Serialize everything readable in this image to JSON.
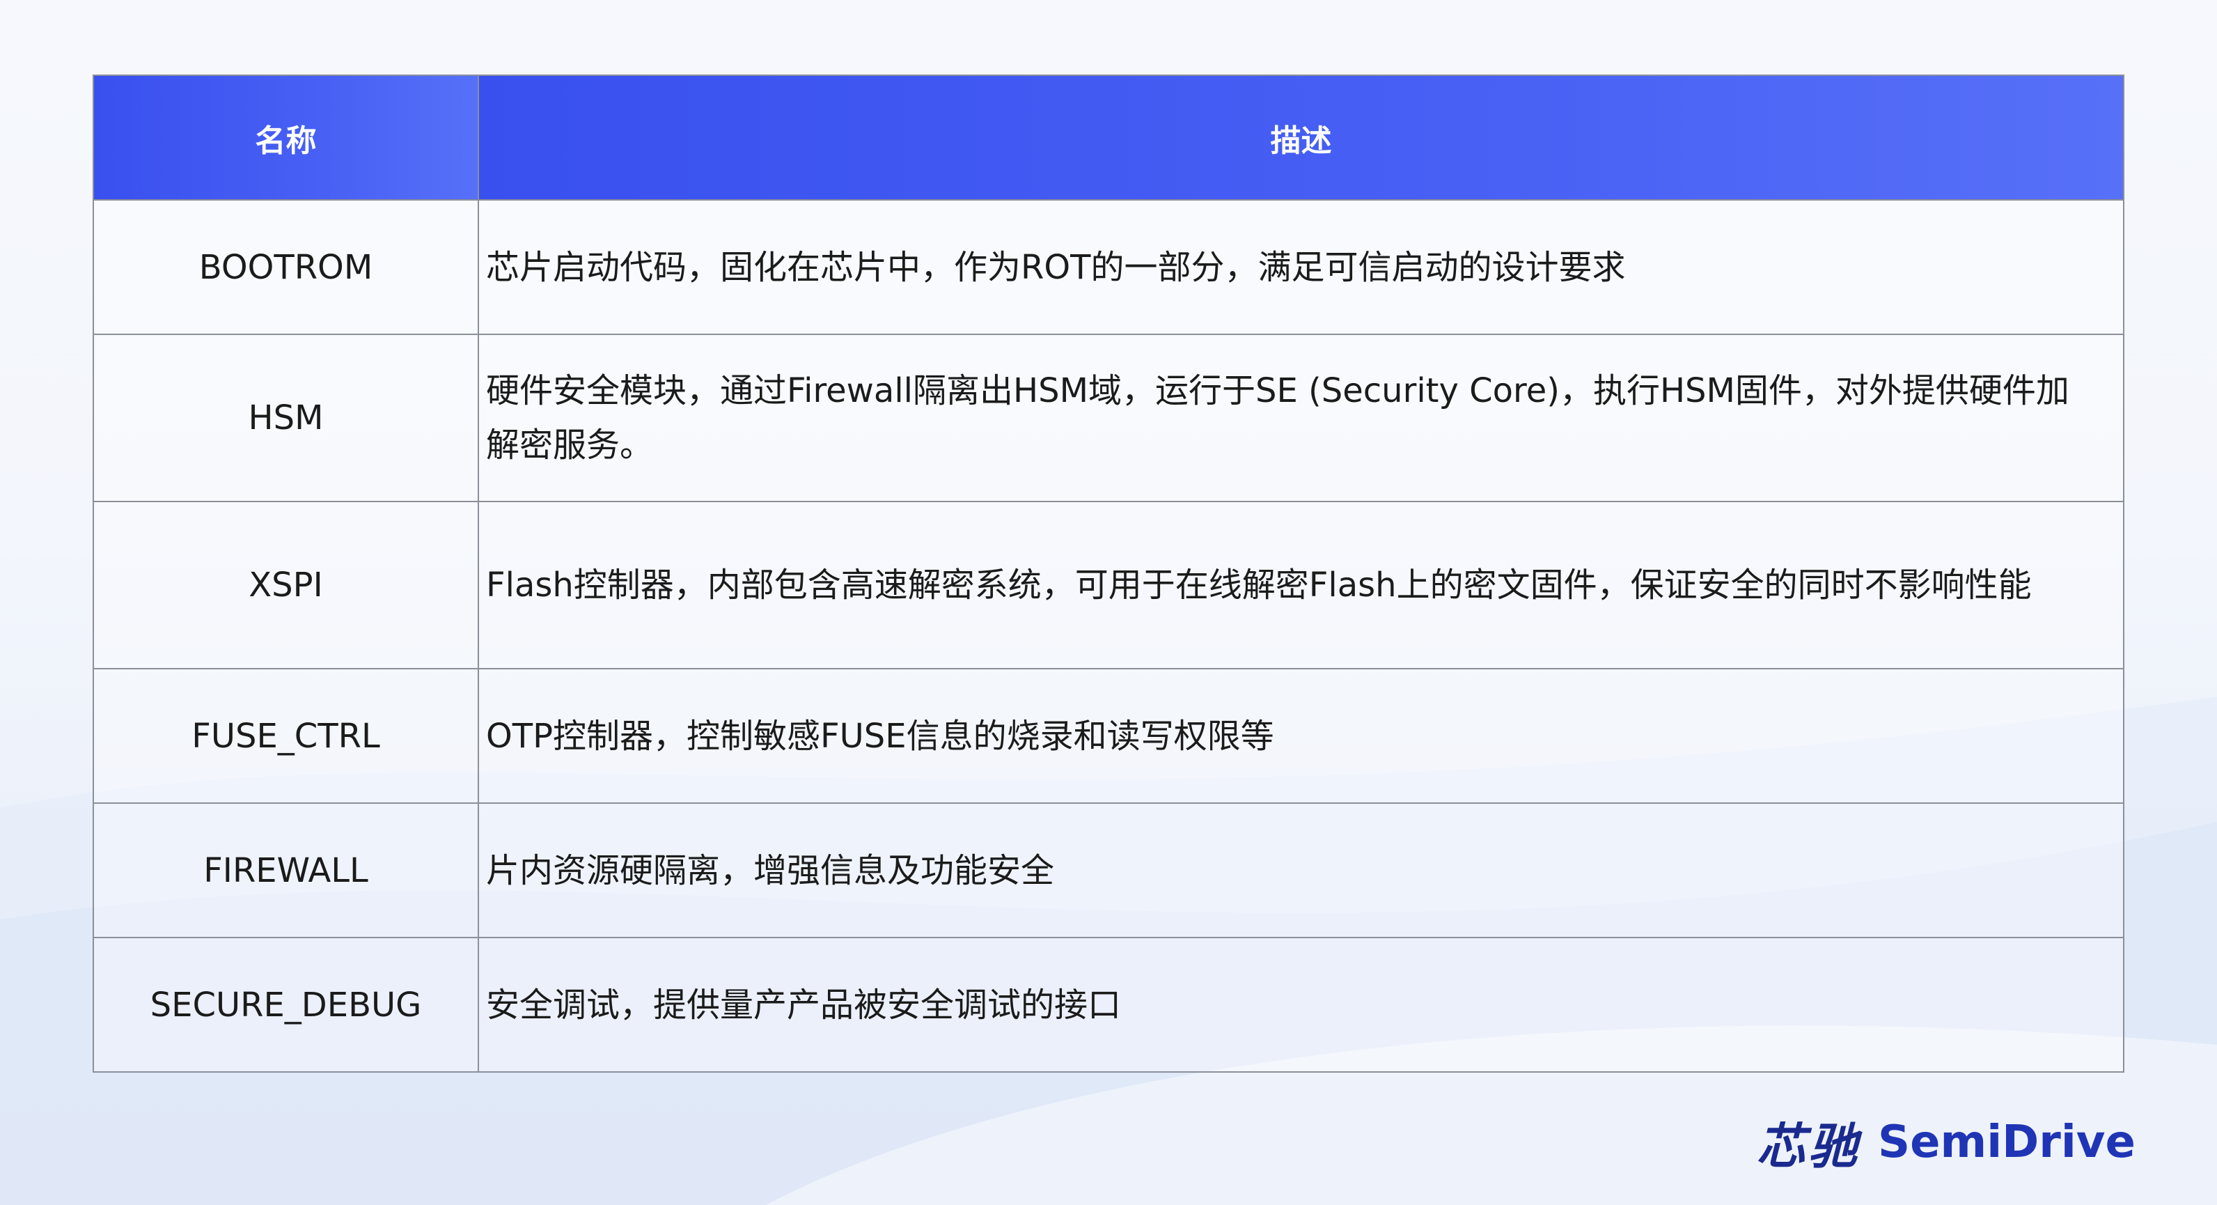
{
  "table": {
    "header": {
      "name": "名称",
      "description": "描述"
    },
    "rows": [
      {
        "name": "BOOTROM",
        "description": "芯片启动代码，固化在芯片中，作为ROT的一部分，满足可信启动的设计要求"
      },
      {
        "name": "HSM",
        "description": "硬件安全模块，通过Firewall隔离出HSM域，运行于SE (Security Core)，执行HSM固件，对外提供硬件加解密服务。"
      },
      {
        "name": "XSPI",
        "description": "Flash控制器，内部包含高速解密系统，可用于在线解密Flash上的密文固件，保证安全的同时不影响性能"
      },
      {
        "name": "FUSE_CTRL",
        "description": "OTP控制器，控制敏感FUSE信息的烧录和读写权限等"
      },
      {
        "name": "FIREWALL",
        "description": "片内资源硬隔离，增强信息及功能安全"
      },
      {
        "name": "SECURE_DEBUG",
        "description": "安全调试，提供量产产品被安全调试的接口"
      }
    ]
  },
  "brand": {
    "cn": "芯驰",
    "en": "SemiDrive"
  },
  "colors": {
    "header": "#4860f4",
    "brand": "#1f35b5",
    "border": "#8a8f99"
  }
}
